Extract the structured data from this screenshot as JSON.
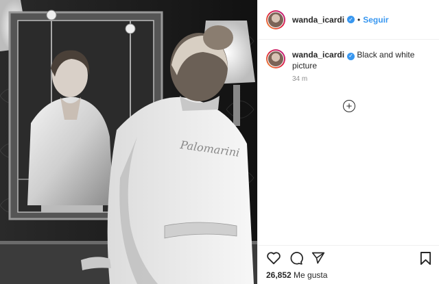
{
  "post": {
    "username": "wanda_icardi",
    "follow_label": "Seguir",
    "separator": "•",
    "caption": "Black and white picture",
    "time": "34 m",
    "likes_count": "26,852",
    "likes_label": "Me gusta"
  },
  "icons": {
    "verified": "verified-badge-icon",
    "load_more": "plus-circle-icon",
    "like": "heart-icon",
    "comment": "comment-icon",
    "share": "paper-plane-icon",
    "save": "bookmark-icon"
  },
  "colors": {
    "link": "#3897f0",
    "text": "#262626",
    "muted": "#8e8e8e",
    "border": "#efefef"
  }
}
